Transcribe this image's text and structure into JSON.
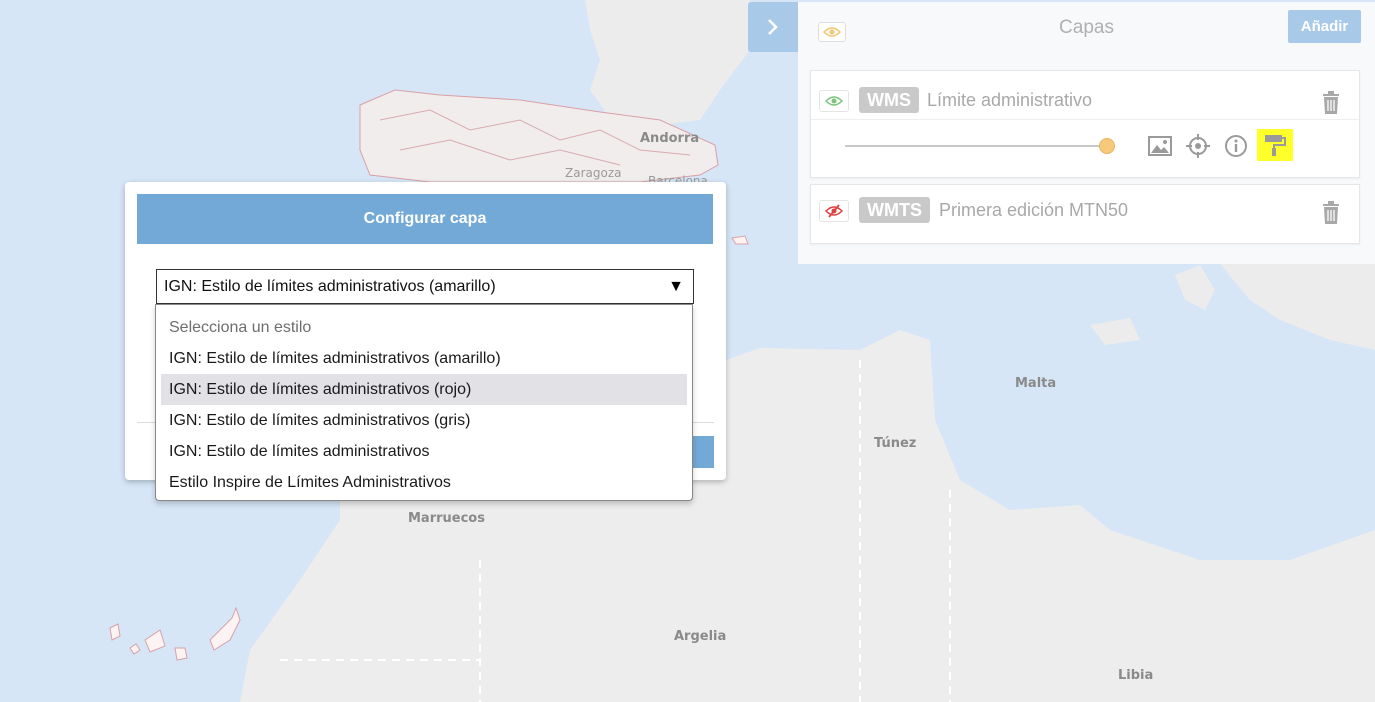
{
  "map": {
    "labels": {
      "andorra": "Andorra",
      "zaragoza": "Zaragoza",
      "barcelona": "Barcelona",
      "malta": "Malta",
      "tunez": "Túnez",
      "marruecos": "Marruecos",
      "argelia": "Argelia",
      "libia": "Libia"
    }
  },
  "layers_panel": {
    "title": "Capas",
    "add_label": "Añadir",
    "layers": [
      {
        "type": "WMS",
        "name": "Límite administrativo",
        "visible": true,
        "opacity": 1.0
      },
      {
        "type": "WMTS",
        "name": "Primera edición MTN50",
        "visible": false
      }
    ]
  },
  "dialog": {
    "title": "Configurar capa",
    "selected_style": "IGN: Estilo de límites administrativos (amarillo)",
    "select_arrow": "▼",
    "options": [
      "Selecciona un estilo",
      "IGN: Estilo de límites administrativos (amarillo)",
      "IGN: Estilo de límites administrativos (rojo)",
      "IGN: Estilo de límites administrativos (gris)",
      "IGN: Estilo de límites administrativos",
      "Estilo Inspire de Límites Administrativos"
    ],
    "hovered_option_index": 2
  },
  "colors": {
    "accent": "#73a9d6",
    "highlight": "#ffff2a",
    "eye_on": "#7cc47c",
    "eye_off": "#e04040",
    "sea": "#d6e6f7",
    "land": "#ededed"
  }
}
